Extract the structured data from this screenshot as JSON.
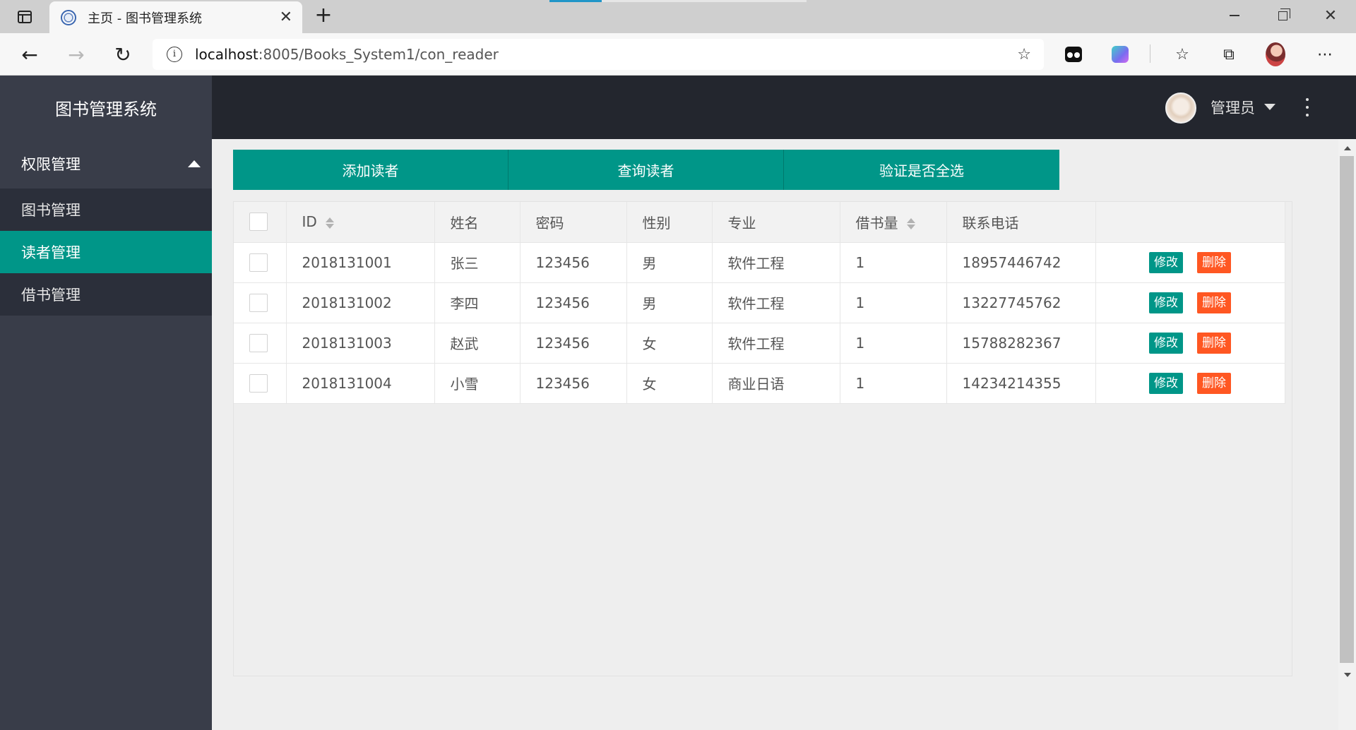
{
  "browser": {
    "tab_title": "主页 - 图书管理系统",
    "tab_close": "✕",
    "new_tab": "+",
    "url_host": "localhost",
    "url_rest": ":8005/Books_System1/con_reader"
  },
  "app": {
    "logo": "图书管理系统",
    "nav": {
      "group_label": "权限管理",
      "items": [
        {
          "label": "图书管理"
        },
        {
          "label": "读者管理"
        },
        {
          "label": "借书管理"
        }
      ]
    },
    "header": {
      "user": "管理员"
    },
    "buttons": {
      "add": "添加读者",
      "query": "查询读者",
      "verify": "验证是否全选"
    },
    "table": {
      "columns": [
        "ID",
        "姓名",
        "密码",
        "性别",
        "专业",
        "借书量",
        "联系电话"
      ],
      "rows": [
        {
          "id": "2018131001",
          "name": "张三",
          "password": "123456",
          "gender": "男",
          "major": "软件工程",
          "borrow": "1",
          "phone": "18957446742"
        },
        {
          "id": "2018131002",
          "name": "李四",
          "password": "123456",
          "gender": "男",
          "major": "软件工程",
          "borrow": "1",
          "phone": "13227745762"
        },
        {
          "id": "2018131003",
          "name": "赵武",
          "password": "123456",
          "gender": "女",
          "major": "软件工程",
          "borrow": "1",
          "phone": "15788282367"
        },
        {
          "id": "2018131004",
          "name": "小雪",
          "password": "123456",
          "gender": "女",
          "major": "商业日语",
          "borrow": "1",
          "phone": "14234214355"
        }
      ],
      "edit_label": "修改",
      "delete_label": "删除"
    }
  },
  "colors": {
    "sidebar": "#393d49",
    "header": "#23262e",
    "accent": "#009688",
    "danger": "#ff5722"
  }
}
